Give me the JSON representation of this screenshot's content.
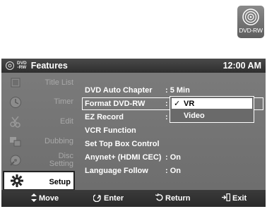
{
  "disc_badge": {
    "label": "DVD-RW",
    "icon": "disc-icon"
  },
  "header": {
    "badge_top": "DVD",
    "badge_bottom": "-RW",
    "title": "Features",
    "clock": "12:00 AM"
  },
  "sidebar": {
    "items": [
      {
        "label": "Title List",
        "icon": "film-icon"
      },
      {
        "label": "Timer",
        "icon": "clock-icon"
      },
      {
        "label": "Edit",
        "icon": "scissors-icon"
      },
      {
        "label": "Dubbing",
        "icon": "dubbing-icon"
      },
      {
        "label_line1": "Disc",
        "label_line2": "Setting",
        "icon": "disc-setting-icon"
      },
      {
        "label": "Setup",
        "icon": "gear-icon"
      }
    ]
  },
  "menu": {
    "rows": [
      {
        "label": "DVD Auto Chapter",
        "value": ": 5 Min"
      },
      {
        "label": "Format DVD-RW",
        "value": ":"
      },
      {
        "label": "EZ Record",
        "value": ":"
      },
      {
        "label": "VCR Function",
        "value": ""
      },
      {
        "label": "Set Top Box Control",
        "value": ""
      },
      {
        "label": "Anynet+ (HDMI CEC)",
        "value": ": On"
      },
      {
        "label": "Language Follow",
        "value": ": On"
      }
    ],
    "dropdown": {
      "options": [
        "VR",
        "Video"
      ],
      "selected": "VR",
      "check": "✓"
    }
  },
  "footer": {
    "move": "Move",
    "enter": "Enter",
    "return": "Return",
    "exit": "Exit"
  },
  "colors": {
    "panel": "#747474",
    "header": "#333333",
    "footer": "#303030",
    "sidebar_text": "#a9a9a9",
    "text": "#ffffff"
  }
}
